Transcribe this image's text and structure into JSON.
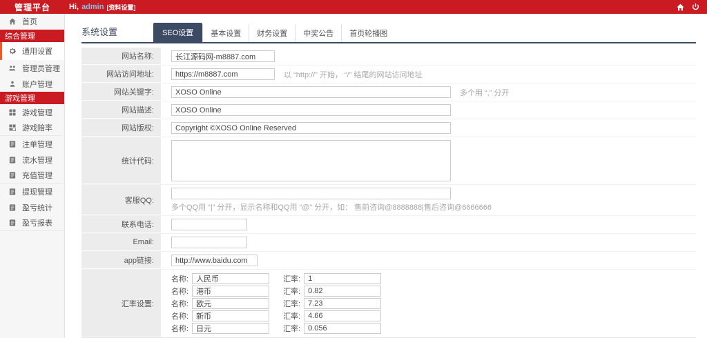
{
  "colors": {
    "primary_red": "#cb1b22",
    "tab_active_navy": "#3d4a63",
    "active_item_accent": "#f05a23",
    "username_blue": "#6fc7ea"
  },
  "header": {
    "brand": "管理平台",
    "greeting_prefix": "Hi,",
    "username": "admin",
    "profile_link": "[资料设置]"
  },
  "sidebar": {
    "items": [
      {
        "label": "首页"
      },
      {
        "label": "综合管理"
      },
      {
        "label": "通用设置"
      },
      {
        "label": "管理员管理"
      },
      {
        "label": "账户管理"
      },
      {
        "label": "游戏管理"
      },
      {
        "label": "游戏管理"
      },
      {
        "label": "游戏赔率"
      },
      {
        "label": "注单管理"
      },
      {
        "label": "流水管理"
      },
      {
        "label": "充值管理"
      },
      {
        "label": "提现管理"
      },
      {
        "label": "盈亏统计"
      },
      {
        "label": "盈亏报表"
      }
    ]
  },
  "main": {
    "title": "系统设置",
    "tabs": [
      {
        "label": "SEO设置",
        "active": true
      },
      {
        "label": "基本设置"
      },
      {
        "label": "财务设置"
      },
      {
        "label": "中奖公告"
      },
      {
        "label": "首页轮播图"
      }
    ],
    "form": {
      "rows": [
        {
          "label": "网站名称:",
          "value": "长江源码网-m8887.com"
        },
        {
          "label": "网站访问地址:",
          "value": "https://m8887.com",
          "hint": "以 “http://” 开始， “/” 结尾的网站访问地址"
        },
        {
          "label": "网站关键字:",
          "value": "XOSO Online",
          "hint": "多个用 “,” 分开"
        },
        {
          "label": "网站描述:",
          "value": "XOSO Online"
        },
        {
          "label": "网站版权:",
          "value": "Copyright ©XOSO Online Reserved"
        },
        {
          "label": "统计代码:",
          "value": ""
        },
        {
          "label": "客服QQ:",
          "value": "",
          "hint": "多个QQ用 “|” 分开，显示名称和QQ用 “@” 分开，如： 售前咨询@8888888|售后咨询@6666666"
        },
        {
          "label": "联系电话:",
          "value": ""
        },
        {
          "label": "Email:",
          "value": ""
        },
        {
          "label": "app链接:",
          "value": "http://www.baidu.com"
        },
        {
          "label": "汇率设置:"
        }
      ],
      "rate_name_label": "名称:",
      "rate_value_label": "汇率:",
      "rates": [
        {
          "name": "人民币",
          "rate": "1"
        },
        {
          "name": "港币",
          "rate": "0.82"
        },
        {
          "name": "欧元",
          "rate": "7.23"
        },
        {
          "name": "新币",
          "rate": "4.66"
        },
        {
          "name": "日元",
          "rate": "0.056"
        }
      ]
    }
  }
}
